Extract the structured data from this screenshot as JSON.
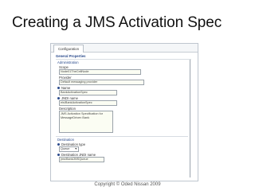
{
  "slide": {
    "title": "Creating a JMS Activation Spec",
    "copyright": "Copyright © Oded Nissan 2009"
  },
  "window": {
    "tab": "Configuration",
    "section_title": "General Properties"
  },
  "administration": {
    "heading": "Administration",
    "scope_label": "Scope",
    "scope_value": "Node01TheCellNode",
    "provider_label": "Provider",
    "provider_value": "Default messaging provider",
    "name_label": "Name",
    "name_value": "BankActivationSpec",
    "jndi_label": "JNDI name",
    "jndi_value": "eis/BankActivationSpec",
    "description_label": "Description",
    "description_value": "JMS Activation Specification for MessageDriven Bank"
  },
  "destination": {
    "heading": "Destination",
    "type_label": "Destination type",
    "type_value": "Queue",
    "jndi_label": "Destination JNDI name",
    "jndi_value": "jms/BankJMSQueue"
  }
}
